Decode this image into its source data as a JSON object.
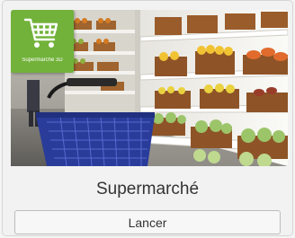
{
  "card": {
    "badge_label": "Supermarché 3D",
    "title": "Supermarché",
    "launch_label": "Lancer",
    "badge_icon": "shopping-cart-icon",
    "badge_color": "#72b23b"
  }
}
